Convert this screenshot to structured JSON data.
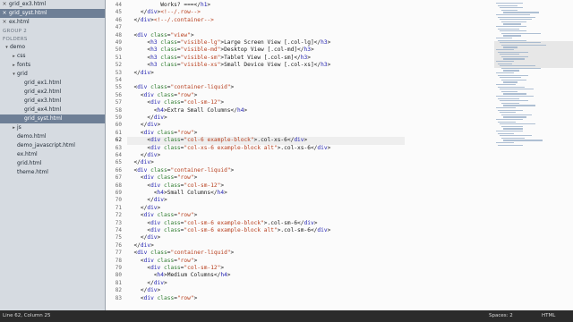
{
  "open_files": [
    {
      "name": "grid_ex3.html",
      "selected": false
    },
    {
      "name": "grid_syst.html",
      "selected": true
    },
    {
      "name": "ex.html",
      "selected": false
    }
  ],
  "folders_header": "FOLDERS",
  "group2_header": "GROUP 2",
  "tree": [
    {
      "name": "demo",
      "arrow": "▾",
      "level": 1,
      "selected": false
    },
    {
      "name": "css",
      "arrow": "▸",
      "level": 2,
      "selected": false
    },
    {
      "name": "fonts",
      "arrow": "▸",
      "level": 2,
      "selected": false
    },
    {
      "name": "grid",
      "arrow": "▾",
      "level": 2,
      "selected": false
    },
    {
      "name": "grid_ex1.html",
      "arrow": "",
      "level": 3,
      "selected": false
    },
    {
      "name": "grid_ex2.html",
      "arrow": "",
      "level": 3,
      "selected": false
    },
    {
      "name": "grid_ex3.html",
      "arrow": "",
      "level": 3,
      "selected": false
    },
    {
      "name": "grid_ex4.html",
      "arrow": "",
      "level": 3,
      "selected": false
    },
    {
      "name": "grid_syst.html",
      "arrow": "",
      "level": 3,
      "selected": true
    },
    {
      "name": "js",
      "arrow": "▸",
      "level": 2,
      "selected": false
    },
    {
      "name": "demo.html",
      "arrow": "",
      "level": 2,
      "selected": false
    },
    {
      "name": "demo_javascript.html",
      "arrow": "",
      "level": 2,
      "selected": false
    },
    {
      "name": "ex.html",
      "arrow": "",
      "level": 2,
      "selected": false
    },
    {
      "name": "grid.html",
      "arrow": "",
      "level": 2,
      "selected": false
    },
    {
      "name": "theme.html",
      "arrow": "",
      "level": 2,
      "selected": false
    }
  ],
  "active_line": 62,
  "code_lines": [
    {
      "n": 44,
      "indent": 10,
      "parts": [
        [
          "x",
          "Works? ===</"
        ],
        [
          "t",
          "h1"
        ],
        [
          "x",
          ">"
        ]
      ]
    },
    {
      "n": 45,
      "indent": 4,
      "parts": [
        [
          "x",
          "</"
        ],
        [
          "t",
          "div"
        ],
        [
          "x",
          ">"
        ],
        [
          "s",
          "<!--/.row-->"
        ]
      ]
    },
    {
      "n": 46,
      "indent": 2,
      "parts": [
        [
          "x",
          "</"
        ],
        [
          "t",
          "div"
        ],
        [
          "x",
          ">"
        ],
        [
          "s",
          "<!--/.container-->"
        ]
      ]
    },
    {
      "n": 47,
      "indent": 0,
      "parts": []
    },
    {
      "n": 48,
      "indent": 2,
      "parts": [
        [
          "x",
          "<"
        ],
        [
          "t",
          "div"
        ],
        [
          "x",
          " "
        ],
        [
          "a",
          "class"
        ],
        [
          "x",
          "="
        ],
        [
          "s",
          "\"view\""
        ],
        [
          "x",
          ">"
        ]
      ]
    },
    {
      "n": 49,
      "indent": 6,
      "parts": [
        [
          "x",
          "<"
        ],
        [
          "t",
          "h3"
        ],
        [
          "x",
          " "
        ],
        [
          "a",
          "class"
        ],
        [
          "x",
          "="
        ],
        [
          "s",
          "\"visible-lg\""
        ],
        [
          "x",
          ">Large Screen View [.col-lg]</"
        ],
        [
          "t",
          "h3"
        ],
        [
          "x",
          ">"
        ]
      ]
    },
    {
      "n": 50,
      "indent": 6,
      "parts": [
        [
          "x",
          "<"
        ],
        [
          "t",
          "h3"
        ],
        [
          "x",
          " "
        ],
        [
          "a",
          "class"
        ],
        [
          "x",
          "="
        ],
        [
          "s",
          "\"visible-md\""
        ],
        [
          "x",
          ">Desktop View [.col-md]</"
        ],
        [
          "t",
          "h3"
        ],
        [
          "x",
          ">"
        ]
      ]
    },
    {
      "n": 51,
      "indent": 6,
      "parts": [
        [
          "x",
          "<"
        ],
        [
          "t",
          "h3"
        ],
        [
          "x",
          " "
        ],
        [
          "a",
          "class"
        ],
        [
          "x",
          "="
        ],
        [
          "s",
          "\"visible-sm\""
        ],
        [
          "x",
          ">Tablet View [.col-sm]</"
        ],
        [
          "t",
          "h3"
        ],
        [
          "x",
          ">"
        ]
      ]
    },
    {
      "n": 52,
      "indent": 6,
      "parts": [
        [
          "x",
          "<"
        ],
        [
          "t",
          "h3"
        ],
        [
          "x",
          " "
        ],
        [
          "a",
          "class"
        ],
        [
          "x",
          "="
        ],
        [
          "s",
          "\"visible-xs\""
        ],
        [
          "x",
          ">Small Device View [.col-xs]</"
        ],
        [
          "t",
          "h3"
        ],
        [
          "x",
          ">"
        ]
      ]
    },
    {
      "n": 53,
      "indent": 2,
      "parts": [
        [
          "x",
          "</"
        ],
        [
          "t",
          "div"
        ],
        [
          "x",
          ">"
        ]
      ]
    },
    {
      "n": 54,
      "indent": 0,
      "parts": []
    },
    {
      "n": 55,
      "indent": 2,
      "parts": [
        [
          "x",
          "<"
        ],
        [
          "t",
          "div"
        ],
        [
          "x",
          " "
        ],
        [
          "a",
          "class"
        ],
        [
          "x",
          "="
        ],
        [
          "s",
          "\"container-liquid\""
        ],
        [
          "x",
          ">"
        ]
      ]
    },
    {
      "n": 56,
      "indent": 4,
      "parts": [
        [
          "x",
          "<"
        ],
        [
          "t",
          "div"
        ],
        [
          "x",
          " "
        ],
        [
          "a",
          "class"
        ],
        [
          "x",
          "="
        ],
        [
          "s",
          "\"row\""
        ],
        [
          "x",
          ">"
        ]
      ]
    },
    {
      "n": 57,
      "indent": 6,
      "parts": [
        [
          "x",
          "<"
        ],
        [
          "t",
          "div"
        ],
        [
          "x",
          " "
        ],
        [
          "a",
          "class"
        ],
        [
          "x",
          "="
        ],
        [
          "s",
          "\"col-sm-12\""
        ],
        [
          "x",
          ">"
        ]
      ]
    },
    {
      "n": 58,
      "indent": 8,
      "parts": [
        [
          "x",
          "<"
        ],
        [
          "t",
          "h4"
        ],
        [
          "x",
          ">Extra Small Columns</"
        ],
        [
          "t",
          "h4"
        ],
        [
          "x",
          ">"
        ]
      ]
    },
    {
      "n": 59,
      "indent": 6,
      "parts": [
        [
          "x",
          "</"
        ],
        [
          "t",
          "div"
        ],
        [
          "x",
          ">"
        ]
      ]
    },
    {
      "n": 60,
      "indent": 4,
      "parts": [
        [
          "x",
          "</"
        ],
        [
          "t",
          "div"
        ],
        [
          "x",
          ">"
        ]
      ]
    },
    {
      "n": 61,
      "indent": 4,
      "parts": [
        [
          "x",
          "<"
        ],
        [
          "t",
          "div"
        ],
        [
          "x",
          " "
        ],
        [
          "a",
          "class"
        ],
        [
          "x",
          "="
        ],
        [
          "s",
          "\"row\""
        ],
        [
          "x",
          ">"
        ]
      ]
    },
    {
      "n": 62,
      "indent": 6,
      "parts": [
        [
          "x",
          "<"
        ],
        [
          "t",
          "div"
        ],
        [
          "x",
          " "
        ],
        [
          "a",
          "class"
        ],
        [
          "x",
          "="
        ],
        [
          "s",
          "\"col-6 example-block\""
        ],
        [
          "x",
          ">.col-xs-6</"
        ],
        [
          "t",
          "div"
        ],
        [
          "x",
          ">"
        ]
      ]
    },
    {
      "n": 63,
      "indent": 6,
      "parts": [
        [
          "x",
          "<"
        ],
        [
          "t",
          "div"
        ],
        [
          "x",
          " "
        ],
        [
          "a",
          "class"
        ],
        [
          "x",
          "="
        ],
        [
          "s",
          "\"col-xs-6 example-block alt\""
        ],
        [
          "x",
          ">.col-xs-6</"
        ],
        [
          "t",
          "div"
        ],
        [
          "x",
          ">"
        ]
      ]
    },
    {
      "n": 64,
      "indent": 4,
      "parts": [
        [
          "x",
          "</"
        ],
        [
          "t",
          "div"
        ],
        [
          "x",
          ">"
        ]
      ]
    },
    {
      "n": 65,
      "indent": 2,
      "parts": [
        [
          "x",
          "</"
        ],
        [
          "t",
          "div"
        ],
        [
          "x",
          ">"
        ]
      ]
    },
    {
      "n": 66,
      "indent": 2,
      "parts": [
        [
          "x",
          "<"
        ],
        [
          "t",
          "div"
        ],
        [
          "x",
          " "
        ],
        [
          "a",
          "class"
        ],
        [
          "x",
          "="
        ],
        [
          "s",
          "\"container-liquid\""
        ],
        [
          "x",
          ">"
        ]
      ]
    },
    {
      "n": 67,
      "indent": 4,
      "parts": [
        [
          "x",
          "<"
        ],
        [
          "t",
          "div"
        ],
        [
          "x",
          " "
        ],
        [
          "a",
          "class"
        ],
        [
          "x",
          "="
        ],
        [
          "s",
          "\"row\""
        ],
        [
          "x",
          ">"
        ]
      ]
    },
    {
      "n": 68,
      "indent": 6,
      "parts": [
        [
          "x",
          "<"
        ],
        [
          "t",
          "div"
        ],
        [
          "x",
          " "
        ],
        [
          "a",
          "class"
        ],
        [
          "x",
          "="
        ],
        [
          "s",
          "\"col-sm-12\""
        ],
        [
          "x",
          ">"
        ]
      ]
    },
    {
      "n": 69,
      "indent": 8,
      "parts": [
        [
          "x",
          "<"
        ],
        [
          "t",
          "h4"
        ],
        [
          "x",
          ">Small Columns</"
        ],
        [
          "t",
          "h4"
        ],
        [
          "x",
          ">"
        ]
      ]
    },
    {
      "n": 70,
      "indent": 6,
      "parts": [
        [
          "x",
          "</"
        ],
        [
          "t",
          "div"
        ],
        [
          "x",
          ">"
        ]
      ]
    },
    {
      "n": 71,
      "indent": 4,
      "parts": [
        [
          "x",
          "</"
        ],
        [
          "t",
          "div"
        ],
        [
          "x",
          ">"
        ]
      ]
    },
    {
      "n": 72,
      "indent": 4,
      "parts": [
        [
          "x",
          "<"
        ],
        [
          "t",
          "div"
        ],
        [
          "x",
          " "
        ],
        [
          "a",
          "class"
        ],
        [
          "x",
          "="
        ],
        [
          "s",
          "\"row\""
        ],
        [
          "x",
          ">"
        ]
      ]
    },
    {
      "n": 73,
      "indent": 6,
      "parts": [
        [
          "x",
          "<"
        ],
        [
          "t",
          "div"
        ],
        [
          "x",
          " "
        ],
        [
          "a",
          "class"
        ],
        [
          "x",
          "="
        ],
        [
          "s",
          "\"col-sm-6 example-block\""
        ],
        [
          "x",
          ">.col-sm-6</"
        ],
        [
          "t",
          "div"
        ],
        [
          "x",
          ">"
        ]
      ]
    },
    {
      "n": 74,
      "indent": 6,
      "parts": [
        [
          "x",
          "<"
        ],
        [
          "t",
          "div"
        ],
        [
          "x",
          " "
        ],
        [
          "a",
          "class"
        ],
        [
          "x",
          "="
        ],
        [
          "s",
          "\"col-sm-6 example-block alt\""
        ],
        [
          "x",
          ">.col-sm-6</"
        ],
        [
          "t",
          "div"
        ],
        [
          "x",
          ">"
        ]
      ]
    },
    {
      "n": 75,
      "indent": 4,
      "parts": [
        [
          "x",
          "</"
        ],
        [
          "t",
          "div"
        ],
        [
          "x",
          ">"
        ]
      ]
    },
    {
      "n": 76,
      "indent": 2,
      "parts": [
        [
          "x",
          "</"
        ],
        [
          "t",
          "div"
        ],
        [
          "x",
          ">"
        ]
      ]
    },
    {
      "n": 77,
      "indent": 2,
      "parts": [
        [
          "x",
          "<"
        ],
        [
          "t",
          "div"
        ],
        [
          "x",
          " "
        ],
        [
          "a",
          "class"
        ],
        [
          "x",
          "="
        ],
        [
          "s",
          "\"container-liquid\""
        ],
        [
          "x",
          ">"
        ]
      ]
    },
    {
      "n": 78,
      "indent": 4,
      "parts": [
        [
          "x",
          "<"
        ],
        [
          "t",
          "div"
        ],
        [
          "x",
          " "
        ],
        [
          "a",
          "class"
        ],
        [
          "x",
          "="
        ],
        [
          "s",
          "\"row\""
        ],
        [
          "x",
          ">"
        ]
      ]
    },
    {
      "n": 79,
      "indent": 6,
      "parts": [
        [
          "x",
          "<"
        ],
        [
          "t",
          "div"
        ],
        [
          "x",
          " "
        ],
        [
          "a",
          "class"
        ],
        [
          "x",
          "="
        ],
        [
          "s",
          "\"col-sm-12\""
        ],
        [
          "x",
          ">"
        ]
      ]
    },
    {
      "n": 80,
      "indent": 8,
      "parts": [
        [
          "x",
          "<"
        ],
        [
          "t",
          "h4"
        ],
        [
          "x",
          ">Medium Columns</"
        ],
        [
          "t",
          "h4"
        ],
        [
          "x",
          ">"
        ]
      ]
    },
    {
      "n": 81,
      "indent": 6,
      "parts": [
        [
          "x",
          "</"
        ],
        [
          "t",
          "div"
        ],
        [
          "x",
          ">"
        ]
      ]
    },
    {
      "n": 82,
      "indent": 4,
      "parts": [
        [
          "x",
          "</"
        ],
        [
          "t",
          "div"
        ],
        [
          "x",
          ">"
        ]
      ]
    },
    {
      "n": 83,
      "indent": 4,
      "parts": [
        [
          "x",
          "<"
        ],
        [
          "t",
          "div"
        ],
        [
          "x",
          " "
        ],
        [
          "a",
          "class"
        ],
        [
          "x",
          "="
        ],
        [
          "s",
          "\"row\""
        ],
        [
          "x",
          ">"
        ]
      ]
    }
  ],
  "status": {
    "position": "Line 62, Column 25",
    "spaces": "Spaces: 2",
    "syntax": "HTML"
  },
  "colors": {
    "sidebar_bg": "#d6dbe1",
    "selected_bg": "#6e7f96",
    "tag": "#1f1fb0",
    "attribute": "#2f7c2f",
    "string": "#b8401f",
    "statusbar_bg": "#2b2b2b"
  }
}
